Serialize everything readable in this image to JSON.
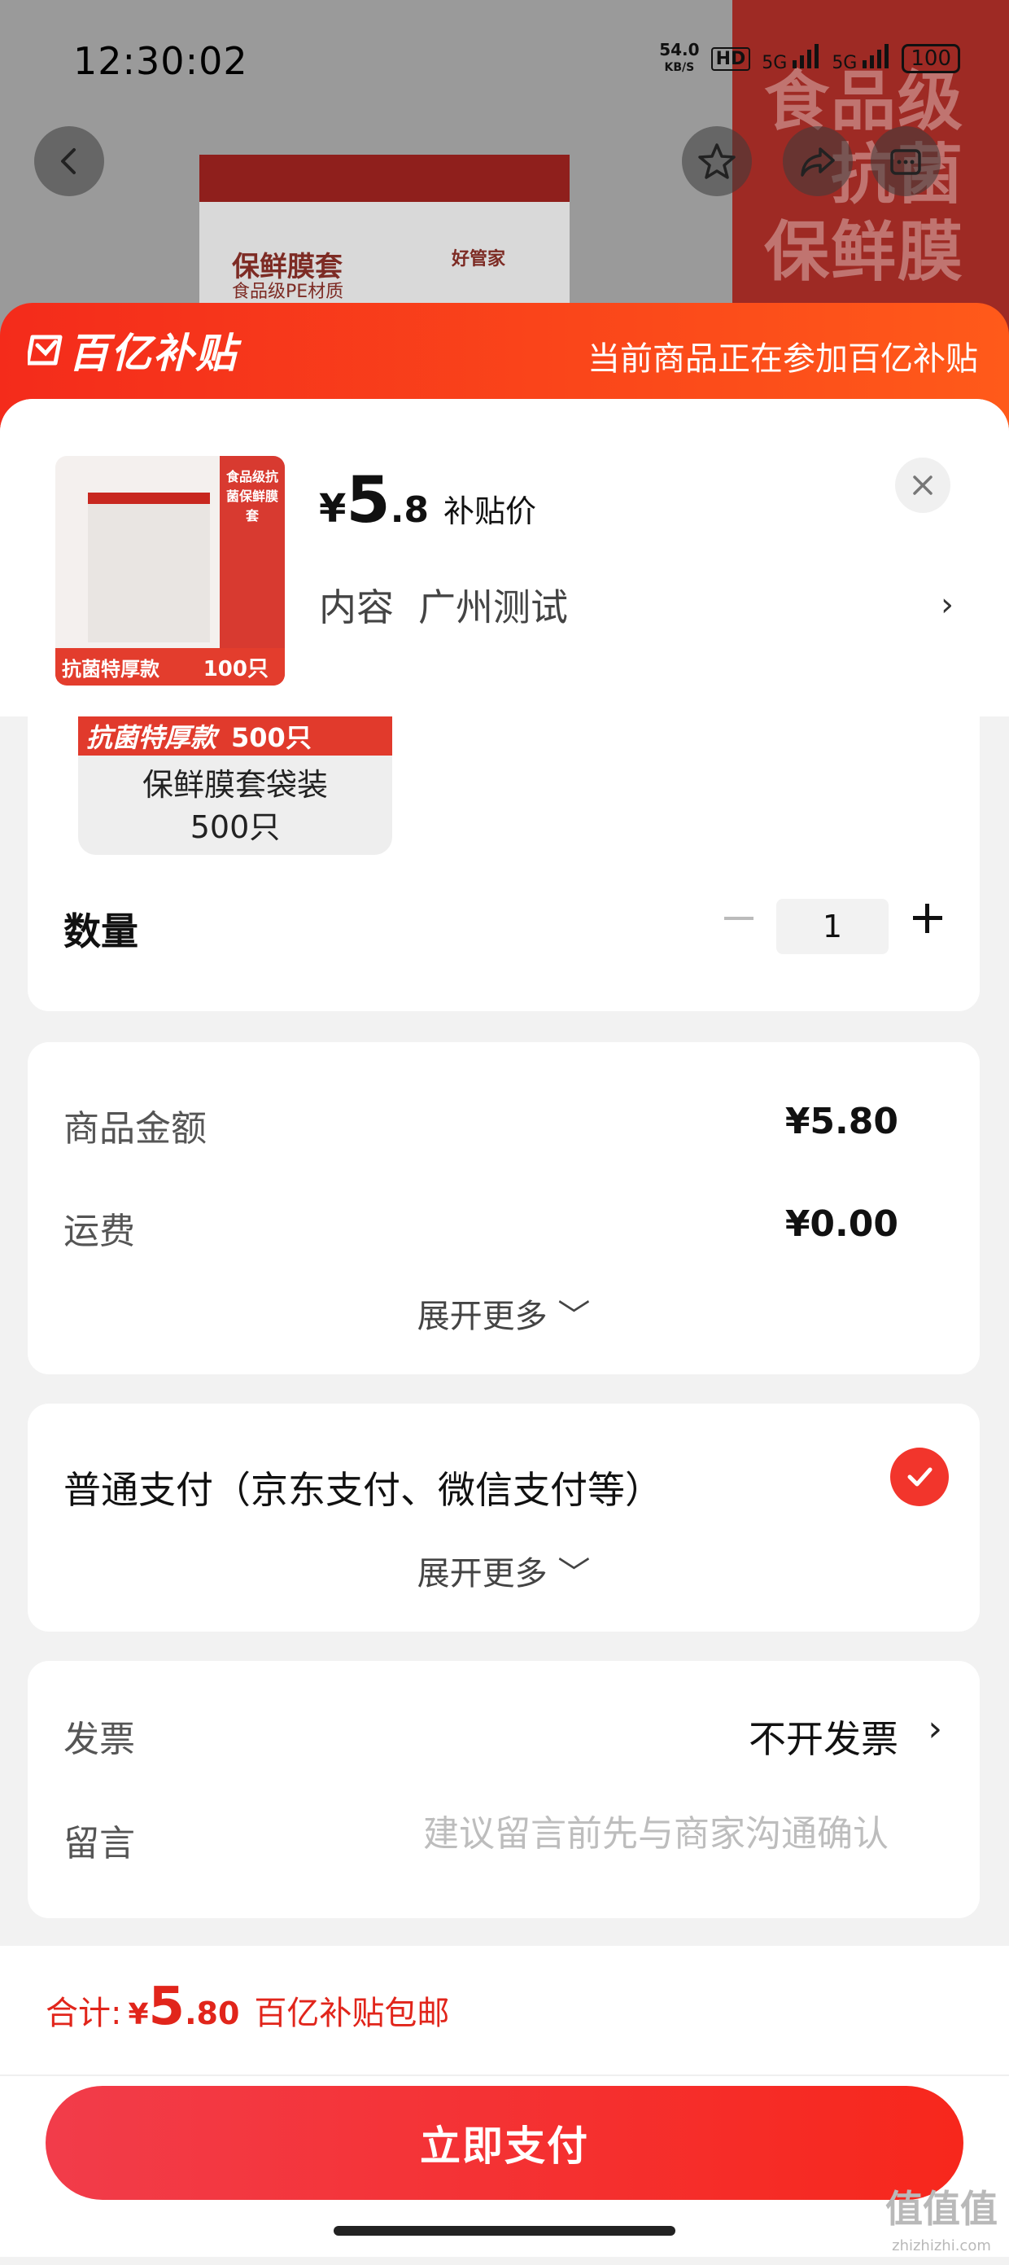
{
  "status_bar": {
    "time": "12:30:02",
    "net_speed_value": "54.0",
    "net_speed_unit": "KB/S",
    "hd": "HD",
    "sim1": "5G",
    "sim2": "5G",
    "battery": "100"
  },
  "background": {
    "banner_line1": "食品级",
    "banner_line2": "抗菌",
    "banner_line3": "保鲜膜",
    "product_title": "保鲜膜套",
    "product_subtitle": "食品级PE材质",
    "product_brand": "好管家"
  },
  "sheet_header": {
    "logo_text": "百亿补贴",
    "note": "当前商品正在参加百亿补贴"
  },
  "product": {
    "thumb_side_text": "食品级抗菌保鲜膜套",
    "thumb_badge_left": "抗菌特厚款",
    "thumb_badge_right": "100只",
    "price_symbol": "¥",
    "price_int": "5",
    "price_dec": ".8",
    "price_tag": "补贴价",
    "spec_label": "内容",
    "spec_value": "广州测试",
    "spec_chevron": "›"
  },
  "sku": {
    "band_left": "抗菌特厚款",
    "band_right": "500只",
    "label_line1": "保鲜膜套袋装",
    "label_line2": "500只"
  },
  "quantity": {
    "label": "数量",
    "value": "1"
  },
  "amounts": {
    "goods_label": "商品金额",
    "goods_value": "¥5.80",
    "shipping_label": "运费",
    "shipping_value": "¥0.00",
    "expand": "展开更多 ﹀"
  },
  "payment": {
    "method_label": "普通支付（京东支付、微信支付等）",
    "expand": "展开更多 ﹀",
    "selected": true
  },
  "invoice": {
    "label": "发票",
    "value": "不开发票",
    "chevron": "›",
    "message_label": "留言",
    "message_placeholder": "建议留言前先与商家沟通确认"
  },
  "footer": {
    "total_label": "合计:",
    "total_yen": "¥",
    "total_int": "5",
    "total_dec": ".80",
    "total_tag": "百亿补贴包邮",
    "pay_button": "立即支付"
  },
  "watermark": {
    "text": "值值值",
    "sub": "zhizhizhi.com"
  },
  "colors": {
    "accent_red": "#f2352c",
    "header_orange": "#ff5a1a",
    "price_red": "#e1251b"
  }
}
